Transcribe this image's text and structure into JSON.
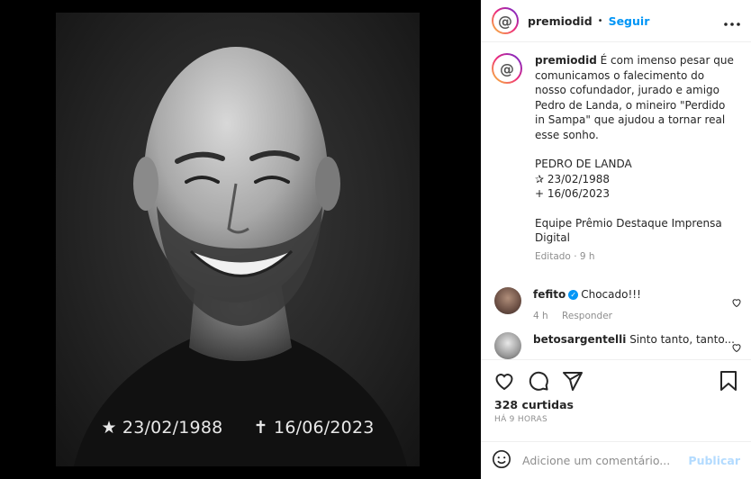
{
  "post": {
    "author": "premiodid",
    "dot": "•",
    "follow_label": "Seguir",
    "more_icon": "more-options-icon",
    "avatar_glyph": "@"
  },
  "media": {
    "birth": "★ 23/02/1988",
    "death": "✝ 16/06/2023"
  },
  "caption": {
    "username": "premiodid",
    "text": "É com imenso pesar que comunicamos o falecimento do nosso cofundador, jurado e amigo Pedro de Landa, o mineiro \"Perdido in Sampa\" que ajudou a tornar real esse sonho.",
    "name_line": "PEDRO DE LANDA",
    "birth_line": "✰ 23/02/1988",
    "death_line": "+ 16/06/2023",
    "sign_line": "Equipe Prêmio Destaque Imprensa Digital",
    "meta": "Editado · 9 h"
  },
  "comments": [
    {
      "username": "fefito",
      "verified": true,
      "text": "Chocado!!!",
      "time": "4 h",
      "reply": "Responder"
    },
    {
      "username": "betosargentelli",
      "verified": false,
      "text": "Sinto tanto, tanto..."
    }
  ],
  "actions": {
    "likes": "328 curtidas",
    "ago": "HÁ 9 HORAS"
  },
  "add_comment": {
    "placeholder": "Adicione um comentário...",
    "publish": "Publicar"
  },
  "colors": {
    "accent": "#0095f6",
    "muted": "#8e8e8e",
    "publish_disabled": "#b3dbff"
  }
}
